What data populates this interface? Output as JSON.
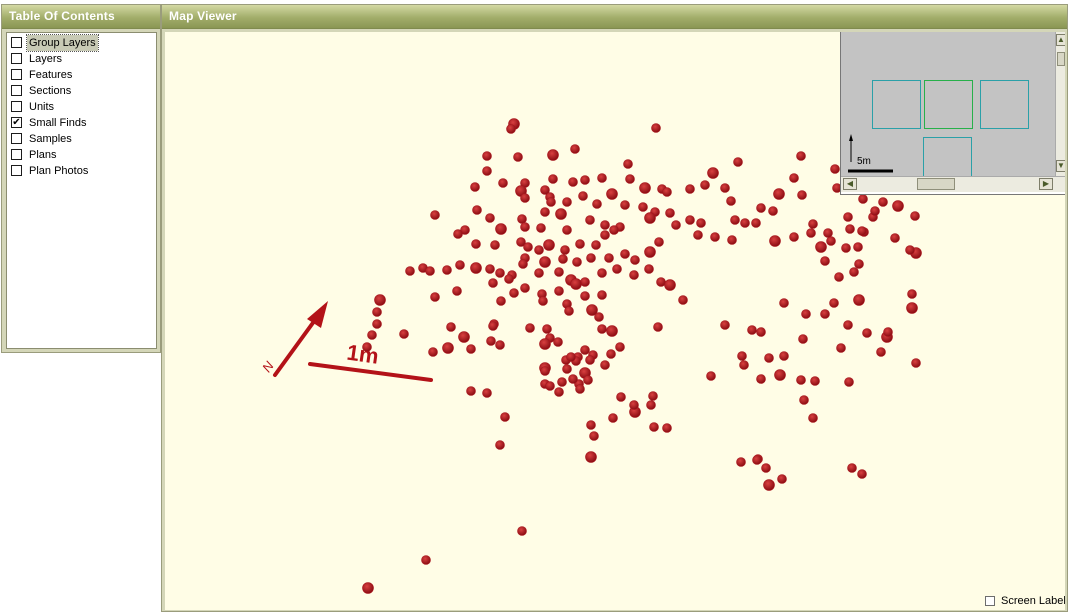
{
  "toc": {
    "title": "Table Of Contents",
    "items": [
      {
        "label": "Group Layers",
        "checked": false,
        "selected": true
      },
      {
        "label": "Layers",
        "checked": false
      },
      {
        "label": "Features",
        "checked": false
      },
      {
        "label": "Sections",
        "checked": false
      },
      {
        "label": "Units",
        "checked": false
      },
      {
        "label": "Small Finds",
        "checked": true
      },
      {
        "label": "Samples",
        "checked": false
      },
      {
        "label": "Plans",
        "checked": false
      },
      {
        "label": "Plan Photos",
        "checked": false
      }
    ]
  },
  "map": {
    "title": "Map Viewer",
    "scale_label": "1m",
    "north_label": "N",
    "find_color": "#a8141c",
    "overview": {
      "scale_label": "5m"
    },
    "screen_label": {
      "label": "Screen Label",
      "checked": false
    }
  }
}
